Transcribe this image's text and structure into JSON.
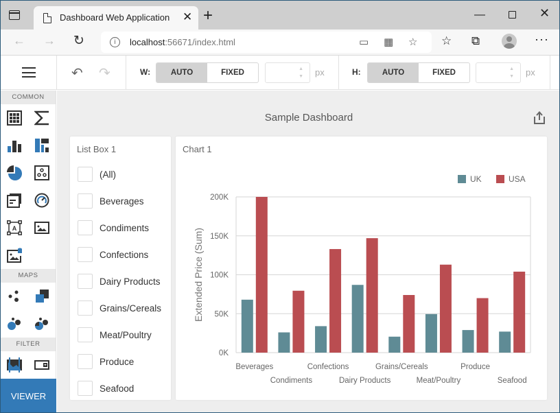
{
  "browser": {
    "tab_title": "Dashboard Web Application",
    "url_host": "localhost",
    "url_rest": ":56671/index.html"
  },
  "toolbar": {
    "width_label": "W:",
    "height_label": "H:",
    "auto_label": "AUTO",
    "fixed_label": "FIXED",
    "unit": "px",
    "width_mode": "AUTO",
    "height_mode": "AUTO"
  },
  "sidebar": {
    "sections": [
      {
        "label": "COMMON",
        "items": [
          "grid-icon",
          "card-sum-icon",
          "chart-icon",
          "treemap-icon",
          "pie-icon",
          "scatter-icon",
          "text-box-icon",
          "gauge-icon",
          "bound-image-icon",
          "image-icon",
          "bound-image-data-icon"
        ]
      },
      {
        "label": "MAPS",
        "items": [
          "geo-point-map-icon",
          "choropleth-map-icon",
          "bubble-map-icon",
          "pie-map-icon"
        ]
      },
      {
        "label": "FILTER",
        "items": [
          "range-filter-icon",
          "combo-box-icon"
        ]
      }
    ],
    "viewer_label": "VIEWER"
  },
  "dashboard": {
    "title": "Sample Dashboard",
    "listbox": {
      "title": "List Box 1",
      "items": [
        "(All)",
        "Beverages",
        "Condiments",
        "Confections",
        "Dairy Products",
        "Grains/Cereals",
        "Meat/Poultry",
        "Produce",
        "Seafood"
      ]
    },
    "chart_title": "Chart 1"
  },
  "chart_data": {
    "type": "bar",
    "title": "Chart 1",
    "xlabel": "",
    "ylabel": "Extended Price (Sum)",
    "ylim": [
      0,
      200000
    ],
    "yticks": [
      "0K",
      "50K",
      "100K",
      "150K",
      "200K"
    ],
    "grid": true,
    "legend_position": "top-right",
    "categories": [
      "Beverages",
      "Condiments",
      "Confections",
      "Dairy Products",
      "Grains/Cereals",
      "Meat/Poultry",
      "Produce",
      "Seafood"
    ],
    "series": [
      {
        "name": "UK",
        "color": "#5f8b95",
        "values": [
          68000,
          26000,
          34000,
          87000,
          20500,
          49500,
          29000,
          27000
        ]
      },
      {
        "name": "USA",
        "color": "#ba4d51",
        "values": [
          200000,
          79500,
          133000,
          147000,
          74000,
          113000,
          70000,
          104000
        ]
      }
    ]
  }
}
